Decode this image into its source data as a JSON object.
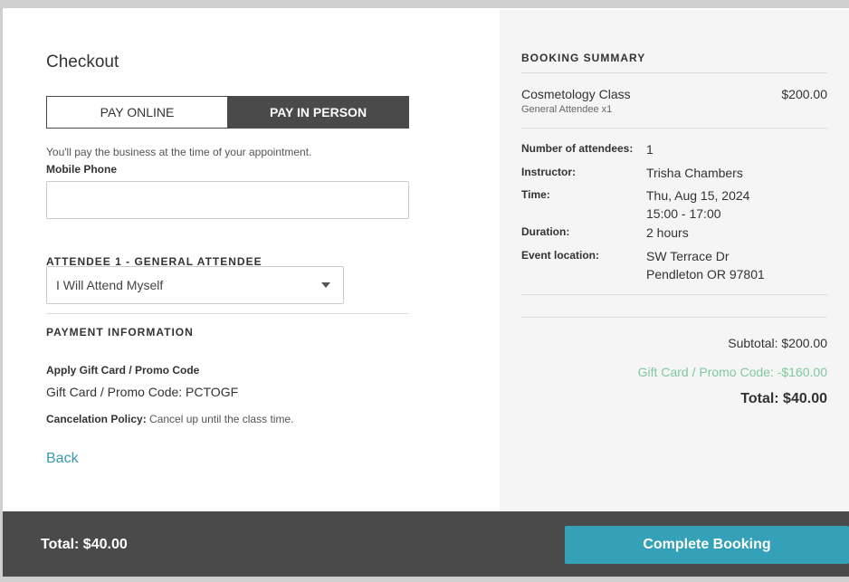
{
  "checkout": {
    "title": "Checkout",
    "toggle": {
      "online_label": "PAY ONLINE",
      "in_person_label": "PAY IN PERSON",
      "selected": "in_person"
    },
    "note": "You'll pay the business at the time of your appointment.",
    "phone": {
      "label": "Mobile Phone",
      "value": "",
      "placeholder": ""
    },
    "attendee": {
      "heading": "ATTENDEE 1 - GENERAL ATTENDEE",
      "selected": "I Will Attend Myself"
    },
    "payment": {
      "heading": "PAYMENT INFORMATION",
      "gift_label": "Apply Gift Card / Promo Code",
      "gift_value": "Gift Card / Promo Code: PCTOGF",
      "policy_label": "Cancelation Policy:",
      "policy_text": " Cancel up until the class time."
    },
    "back_label": "Back"
  },
  "summary": {
    "heading": "BOOKING SUMMARY",
    "item": {
      "name": "Cosmetology Class",
      "sub": "General Attendee x1",
      "price": "$200.00"
    },
    "details": [
      {
        "key": "Number of attendees:",
        "value": [
          "1"
        ]
      },
      {
        "key": "Instructor:",
        "value": [
          "Trisha Chambers"
        ]
      },
      {
        "key": "Time:",
        "value": [
          "Thu, Aug 15, 2024",
          "15:00 - 17:00"
        ]
      },
      {
        "key": "Duration:",
        "value": [
          "2 hours"
        ]
      },
      {
        "key": "Event location:",
        "value": [
          "SW Terrace Dr",
          "Pendleton OR 97801"
        ]
      }
    ],
    "subtotal": "Subtotal: $200.00",
    "discount": "Gift Card / Promo Code: -$160.00",
    "total": "Total: $40.00"
  },
  "footer": {
    "total": "Total: $40.00",
    "complete_label": "Complete Booking"
  },
  "colors": {
    "accent": "#34a1b8",
    "dark": "#4a4a4a",
    "discount": "#7fc9a0"
  }
}
